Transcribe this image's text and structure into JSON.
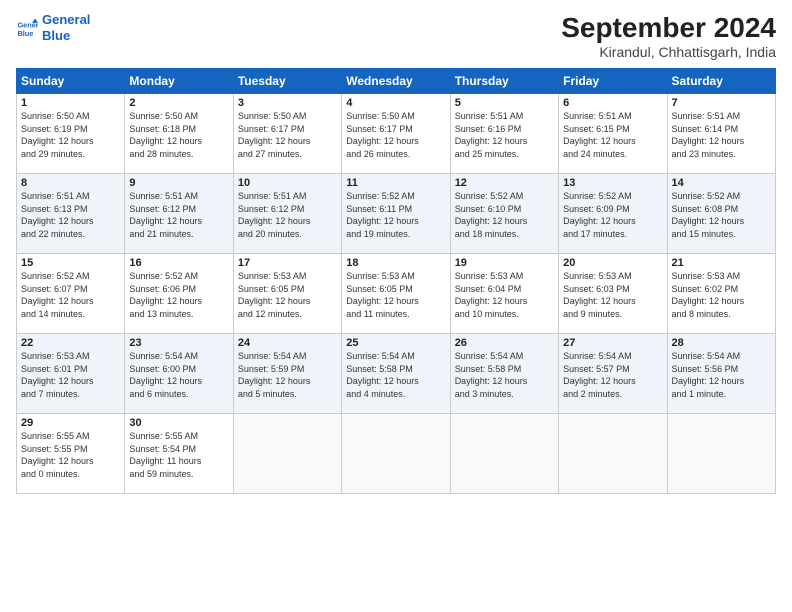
{
  "header": {
    "logo_line1": "General",
    "logo_line2": "Blue",
    "month_title": "September 2024",
    "location": "Kirandul, Chhattisgarh, India"
  },
  "weekdays": [
    "Sunday",
    "Monday",
    "Tuesday",
    "Wednesday",
    "Thursday",
    "Friday",
    "Saturday"
  ],
  "weeks": [
    [
      {
        "day": "1",
        "info": "Sunrise: 5:50 AM\nSunset: 6:19 PM\nDaylight: 12 hours\nand 29 minutes."
      },
      {
        "day": "2",
        "info": "Sunrise: 5:50 AM\nSunset: 6:18 PM\nDaylight: 12 hours\nand 28 minutes."
      },
      {
        "day": "3",
        "info": "Sunrise: 5:50 AM\nSunset: 6:17 PM\nDaylight: 12 hours\nand 27 minutes."
      },
      {
        "day": "4",
        "info": "Sunrise: 5:50 AM\nSunset: 6:17 PM\nDaylight: 12 hours\nand 26 minutes."
      },
      {
        "day": "5",
        "info": "Sunrise: 5:51 AM\nSunset: 6:16 PM\nDaylight: 12 hours\nand 25 minutes."
      },
      {
        "day": "6",
        "info": "Sunrise: 5:51 AM\nSunset: 6:15 PM\nDaylight: 12 hours\nand 24 minutes."
      },
      {
        "day": "7",
        "info": "Sunrise: 5:51 AM\nSunset: 6:14 PM\nDaylight: 12 hours\nand 23 minutes."
      }
    ],
    [
      {
        "day": "8",
        "info": "Sunrise: 5:51 AM\nSunset: 6:13 PM\nDaylight: 12 hours\nand 22 minutes."
      },
      {
        "day": "9",
        "info": "Sunrise: 5:51 AM\nSunset: 6:12 PM\nDaylight: 12 hours\nand 21 minutes."
      },
      {
        "day": "10",
        "info": "Sunrise: 5:51 AM\nSunset: 6:12 PM\nDaylight: 12 hours\nand 20 minutes."
      },
      {
        "day": "11",
        "info": "Sunrise: 5:52 AM\nSunset: 6:11 PM\nDaylight: 12 hours\nand 19 minutes."
      },
      {
        "day": "12",
        "info": "Sunrise: 5:52 AM\nSunset: 6:10 PM\nDaylight: 12 hours\nand 18 minutes."
      },
      {
        "day": "13",
        "info": "Sunrise: 5:52 AM\nSunset: 6:09 PM\nDaylight: 12 hours\nand 17 minutes."
      },
      {
        "day": "14",
        "info": "Sunrise: 5:52 AM\nSunset: 6:08 PM\nDaylight: 12 hours\nand 15 minutes."
      }
    ],
    [
      {
        "day": "15",
        "info": "Sunrise: 5:52 AM\nSunset: 6:07 PM\nDaylight: 12 hours\nand 14 minutes."
      },
      {
        "day": "16",
        "info": "Sunrise: 5:52 AM\nSunset: 6:06 PM\nDaylight: 12 hours\nand 13 minutes."
      },
      {
        "day": "17",
        "info": "Sunrise: 5:53 AM\nSunset: 6:05 PM\nDaylight: 12 hours\nand 12 minutes."
      },
      {
        "day": "18",
        "info": "Sunrise: 5:53 AM\nSunset: 6:05 PM\nDaylight: 12 hours\nand 11 minutes."
      },
      {
        "day": "19",
        "info": "Sunrise: 5:53 AM\nSunset: 6:04 PM\nDaylight: 12 hours\nand 10 minutes."
      },
      {
        "day": "20",
        "info": "Sunrise: 5:53 AM\nSunset: 6:03 PM\nDaylight: 12 hours\nand 9 minutes."
      },
      {
        "day": "21",
        "info": "Sunrise: 5:53 AM\nSunset: 6:02 PM\nDaylight: 12 hours\nand 8 minutes."
      }
    ],
    [
      {
        "day": "22",
        "info": "Sunrise: 5:53 AM\nSunset: 6:01 PM\nDaylight: 12 hours\nand 7 minutes."
      },
      {
        "day": "23",
        "info": "Sunrise: 5:54 AM\nSunset: 6:00 PM\nDaylight: 12 hours\nand 6 minutes."
      },
      {
        "day": "24",
        "info": "Sunrise: 5:54 AM\nSunset: 5:59 PM\nDaylight: 12 hours\nand 5 minutes."
      },
      {
        "day": "25",
        "info": "Sunrise: 5:54 AM\nSunset: 5:58 PM\nDaylight: 12 hours\nand 4 minutes."
      },
      {
        "day": "26",
        "info": "Sunrise: 5:54 AM\nSunset: 5:58 PM\nDaylight: 12 hours\nand 3 minutes."
      },
      {
        "day": "27",
        "info": "Sunrise: 5:54 AM\nSunset: 5:57 PM\nDaylight: 12 hours\nand 2 minutes."
      },
      {
        "day": "28",
        "info": "Sunrise: 5:54 AM\nSunset: 5:56 PM\nDaylight: 12 hours\nand 1 minute."
      }
    ],
    [
      {
        "day": "29",
        "info": "Sunrise: 5:55 AM\nSunset: 5:55 PM\nDaylight: 12 hours\nand 0 minutes."
      },
      {
        "day": "30",
        "info": "Sunrise: 5:55 AM\nSunset: 5:54 PM\nDaylight: 11 hours\nand 59 minutes."
      },
      {
        "day": "",
        "info": ""
      },
      {
        "day": "",
        "info": ""
      },
      {
        "day": "",
        "info": ""
      },
      {
        "day": "",
        "info": ""
      },
      {
        "day": "",
        "info": ""
      }
    ]
  ]
}
